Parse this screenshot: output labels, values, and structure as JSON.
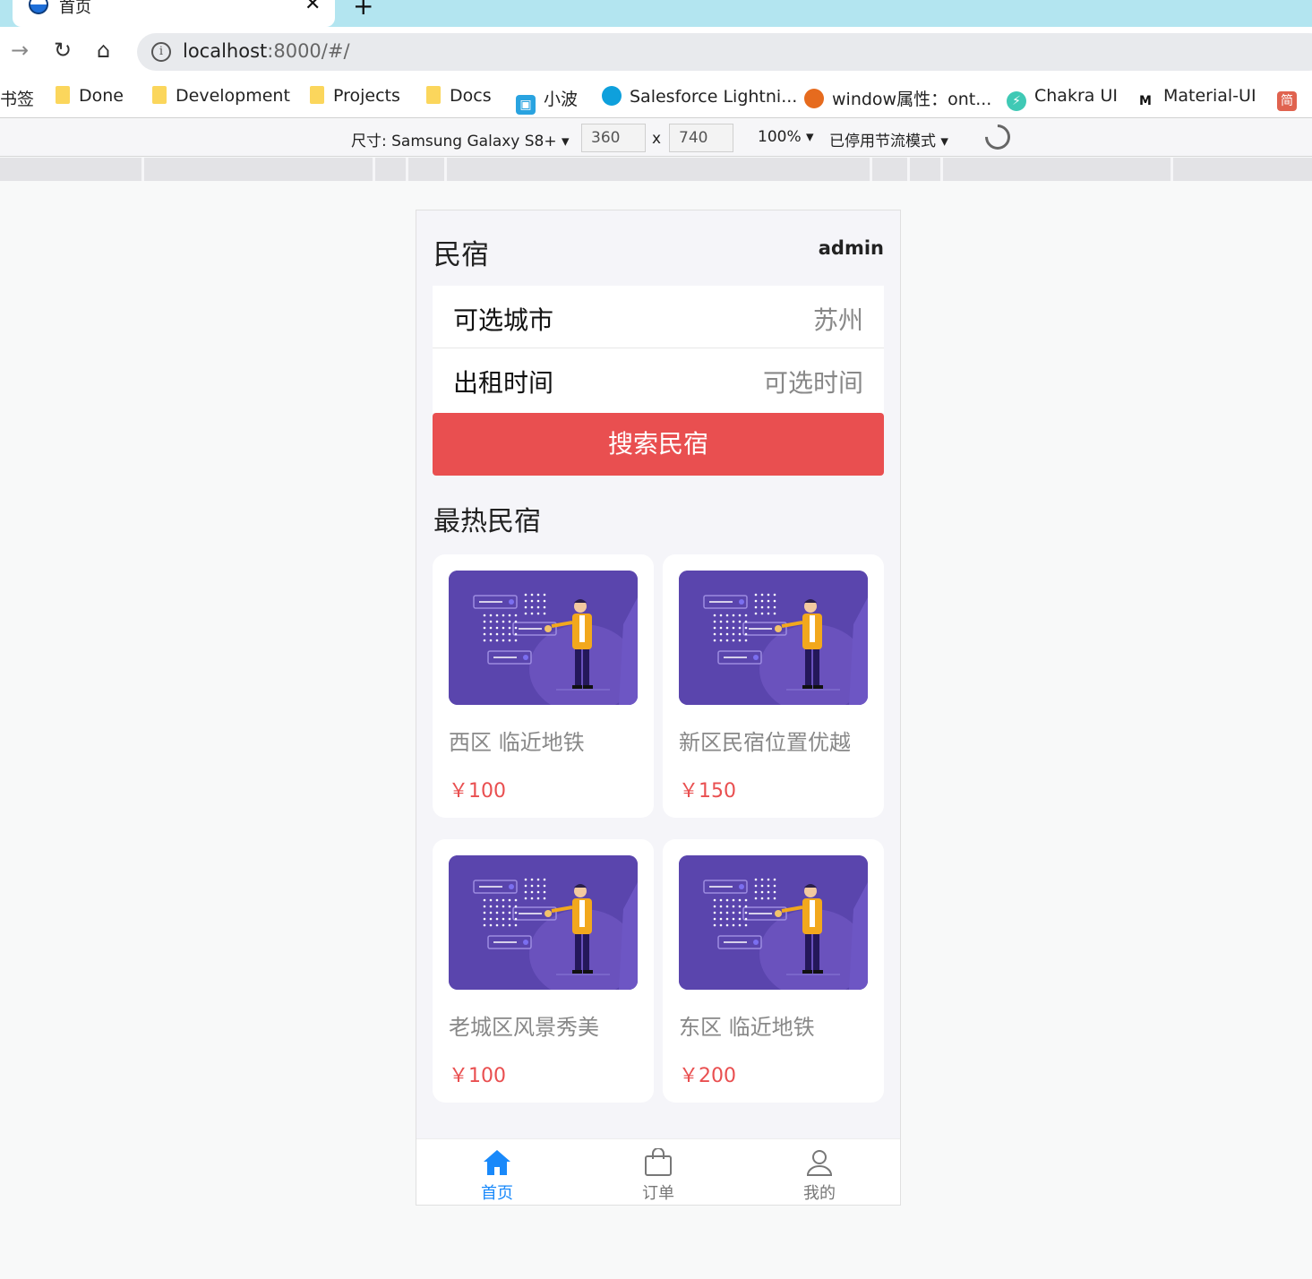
{
  "browser": {
    "tab_title": "首页",
    "tab_close": "✕",
    "new_tab": "+",
    "url_host": "localhost",
    "url_rest": ":8000/#/",
    "bookmarks": [
      {
        "label": "书签"
      },
      {
        "label": "Done"
      },
      {
        "label": "Development"
      },
      {
        "label": "Projects"
      },
      {
        "label": "Docs"
      },
      {
        "label": "小波"
      },
      {
        "label": "Salesforce Lightni..."
      },
      {
        "label": "window属性：ont..."
      },
      {
        "label": "Chakra UI"
      },
      {
        "label": "Material-UI"
      },
      {
        "label": "简"
      }
    ],
    "devtools": {
      "device_label": "尺寸: Samsung Galaxy S8+ ▾",
      "width": "360",
      "times": "x",
      "height": "740",
      "zoom": "100% ▾",
      "throttle": "已停用节流模式 ▾"
    }
  },
  "app": {
    "title": "民宿",
    "user": "admin",
    "form": {
      "city_label": "可选城市",
      "city_value": "苏州",
      "time_label": "出租时间",
      "time_value": "可选时间"
    },
    "search_button": "搜索民宿",
    "hot_title": "最热民宿",
    "listings": [
      {
        "name": "西区 临近地铁",
        "price": "￥100"
      },
      {
        "name": "新区民宿位置优越",
        "price": "￥150"
      },
      {
        "name": "老城区风景秀美",
        "price": "￥100"
      },
      {
        "name": "东区 临近地铁",
        "price": "￥200"
      }
    ],
    "tabbar": [
      {
        "label": "首页",
        "icon": "home-icon",
        "active": true
      },
      {
        "label": "订单",
        "icon": "bag-icon",
        "active": false
      },
      {
        "label": "我的",
        "icon": "user-icon",
        "active": false
      }
    ],
    "colors": {
      "primary_red": "#e94f50",
      "active_blue": "#1989fa",
      "image_purple": "#5a45ad",
      "figure_yellow": "#f2a81d"
    }
  }
}
